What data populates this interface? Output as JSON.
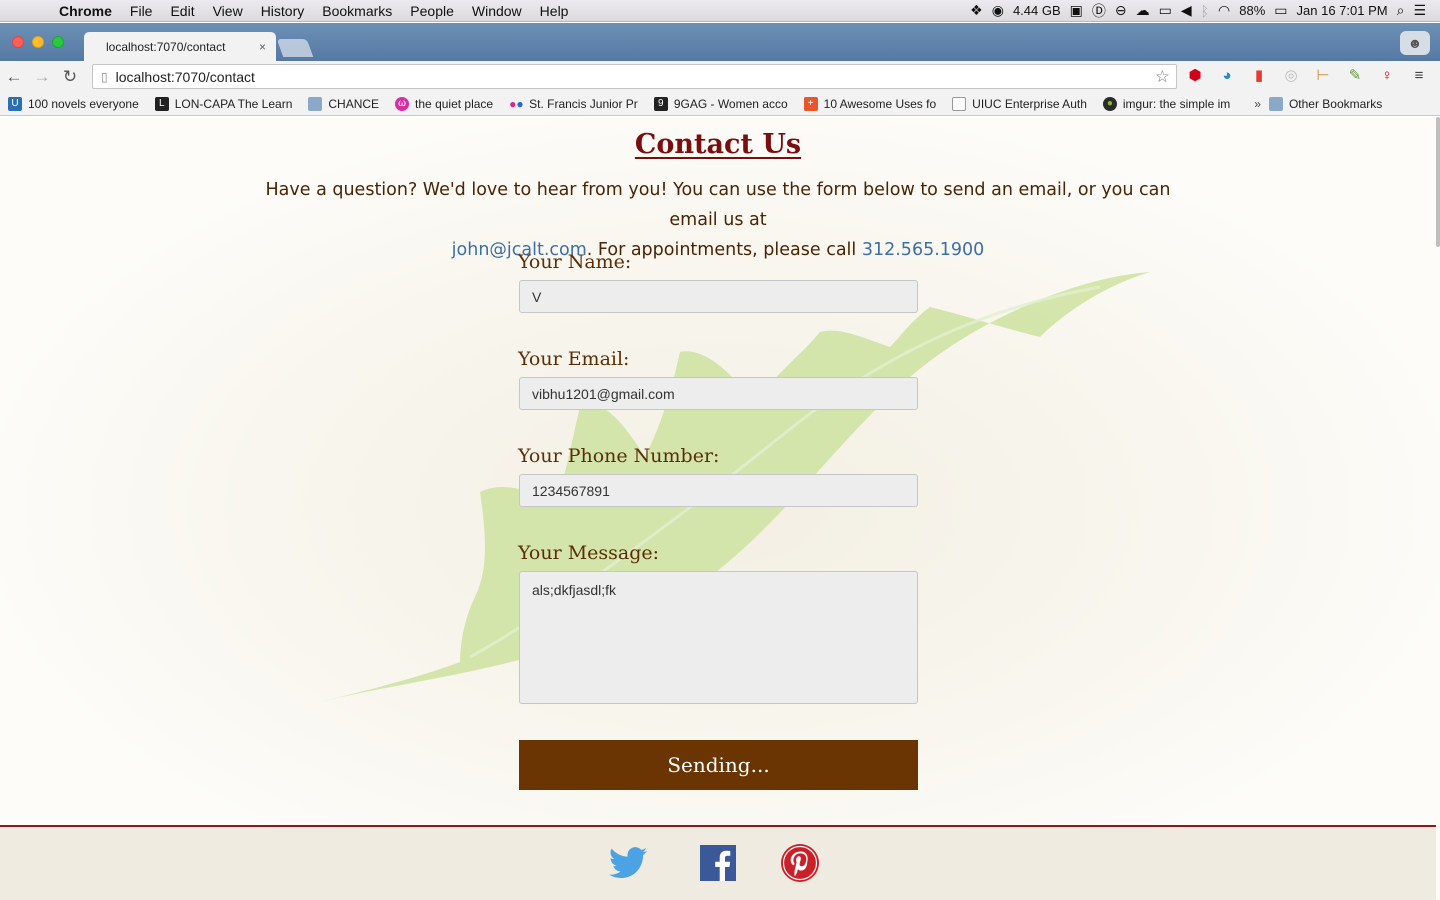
{
  "menubar": {
    "app": "Chrome",
    "items": [
      "File",
      "Edit",
      "View",
      "History",
      "Bookmarks",
      "People",
      "Window",
      "Help"
    ],
    "memory": "4.44 GB",
    "battery": "88%",
    "datetime": "Jan 16  7:01 PM"
  },
  "tab": {
    "title": "localhost:7070/contact",
    "close": "×"
  },
  "toolbar": {
    "url": "localhost:7070/contact"
  },
  "bookmarks": {
    "items": [
      {
        "label": "100 novels everyone",
        "icon": "u-icon",
        "color": "#2a6fb3"
      },
      {
        "label": "LON-CAPA The Learn",
        "icon": "lon-capa-icon",
        "color": "#222222"
      },
      {
        "label": "CHANCE",
        "icon": "folder-icon",
        "color": "#8aa9c9"
      },
      {
        "label": "the quiet place",
        "icon": "quiet-place-icon",
        "color": "#d62fa4"
      },
      {
        "label": "St. Francis Junior Pr",
        "icon": "flickr-dots-icon",
        "color": "#e0218a"
      },
      {
        "label": "9GAG - Women acco",
        "icon": "9gag-icon",
        "color": "#222222"
      },
      {
        "label": "10 Awesome Uses fo",
        "icon": "plus-icon",
        "color": "#e8562a"
      },
      {
        "label": "UIUC Enterprise Auth",
        "icon": "page-icon",
        "color": "#999999"
      },
      {
        "label": "imgur: the simple im",
        "icon": "imgur-icon",
        "color": "#2b2b2b"
      }
    ],
    "more": "»",
    "other": "Other Bookmarks"
  },
  "page": {
    "title": "Contact Us",
    "intro_1": "Have a question? We'd love to hear from you! You can use the form below to send an email, or you can email us at",
    "email_link": "john@jcalt.com",
    "intro_2": ". For appointments, please call ",
    "phone_link": "312.565.1900",
    "form": {
      "name_label": "Your Name:",
      "name_value": "V",
      "email_label": "Your Email:",
      "email_value": "vibhu1201@gmail.com",
      "phone_label": "Your Phone Number:",
      "phone_value": "1234567891",
      "message_label": "Your Message:",
      "message_value": "als;dkfjasdl;fk",
      "submit_label": "Sending..."
    },
    "footer": {
      "social": [
        "twitter-icon",
        "facebook-icon",
        "pinterest-icon"
      ]
    },
    "colors": {
      "heading": "#7a0e0e",
      "button": "#6a3403",
      "link": "#3c6ea8",
      "leaf": "#cfe3a4"
    }
  }
}
